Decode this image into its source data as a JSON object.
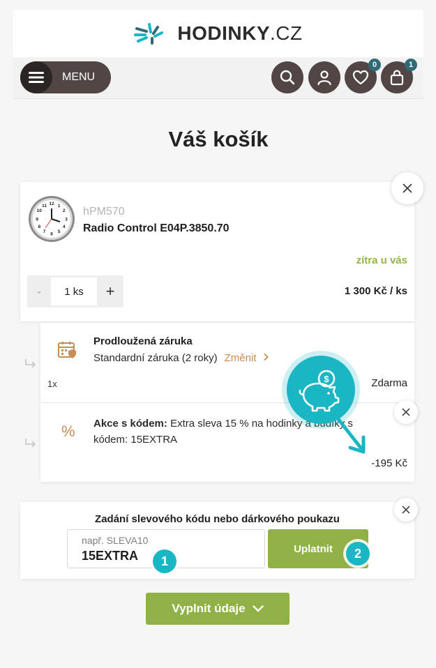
{
  "header": {
    "logo_text": "HODINKY",
    "logo_domain": ".CZ",
    "menu_label": "MENU",
    "wishlist_count": "0",
    "cart_count": "1"
  },
  "page_title": "Váš košík",
  "product": {
    "sku": "hPM570",
    "name": "Radio Control E04P.3850.70",
    "delivery": "zítra u vás",
    "qty_minus": "-",
    "qty_value": "1 ks",
    "qty_plus": "+",
    "unit_price": "1 300 Kč / ks"
  },
  "warranty": {
    "title": "Prodloužená záruka",
    "description": "Standardní záruka (2 roky)",
    "change_label": "Změnit",
    "qty": "1x",
    "price": "Zdarma"
  },
  "promo": {
    "label": "Akce s kódem:",
    "text": "Extra sleva 15 % na hodinky a budíky s kódem: 15EXTRA",
    "amount": "-195 Kč"
  },
  "coupon": {
    "title": "Zadání slevového kódu nebo dárkového poukazu",
    "placeholder": "např. SLEVA10",
    "value": "15EXTRA",
    "apply_label": "Uplatnit",
    "step1": "1",
    "step2": "2"
  },
  "submit_label": "Vyplnit údaje",
  "colors": {
    "accent_green": "#8fb146",
    "teal": "#1bb6c3",
    "dark_button": "#514644",
    "copper": "#c88d54"
  }
}
